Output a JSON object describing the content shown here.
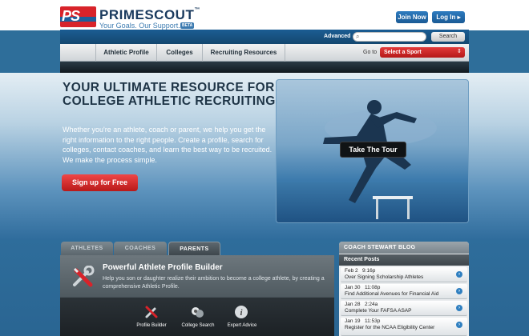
{
  "header": {
    "logo_text": "PS",
    "brand": "PRIMESCOUT",
    "tm": "™",
    "tagline": "Your Goals. Our Support.",
    "beta": "BETA",
    "join_label": "Join Now",
    "login_label": "Log In",
    "login_arrow": "▸"
  },
  "search": {
    "advanced_label": "Advanced",
    "value": "",
    "button_label": "Search"
  },
  "nav": {
    "items": [
      "Athletic Profile",
      "Colleges",
      "Recruiting Resources"
    ],
    "goto_label": "Go to",
    "sport_select": "Select a Sport"
  },
  "hero": {
    "title": "YOUR ULTIMATE RESOURCE FOR COLLEGE ATHLETIC RECRUITING",
    "text": "Whether you're an athlete, coach or parent, we help you get the right information to the right people. Create a profile, search for colleges, contact coaches, and learn the best way to be recruited. We make the process simple.",
    "signup_label": "Sign up for Free",
    "tour_label": "Take The Tour"
  },
  "tabs": {
    "items": [
      "ATHLETES",
      "COACHES",
      "PARENTS"
    ],
    "active": "PARENTS"
  },
  "panel": {
    "title": "Powerful Athlete Profile Builder",
    "text": "Help you son or daughter realize their ambition to become a college athlete, by creating a comprehensive Athletic Profile.",
    "icons": [
      "Profile Builder",
      "College Search",
      "Expert Advice"
    ]
  },
  "blog": {
    "heading": "COACH STEWART BLOG",
    "recent_label": "Recent Posts",
    "posts": [
      {
        "date": "Feb 2",
        "time": "9:16p",
        "title": "Over Signing Scholarship Athletes"
      },
      {
        "date": "Jan 30",
        "time": "11:08p",
        "title": "Find Additional Avenues for Financial Aid"
      },
      {
        "date": "Jan 28",
        "time": "2:24a",
        "title": "Complete Your FAFSA ASAP"
      },
      {
        "date": "Jan 19",
        "time": "11:53p",
        "title": "Register for the NCAA Eligibility Center"
      }
    ]
  },
  "colors": {
    "brand_red": "#d8232a",
    "brand_blue": "#1e5e9a",
    "accent_blue": "#2e7bbf"
  }
}
